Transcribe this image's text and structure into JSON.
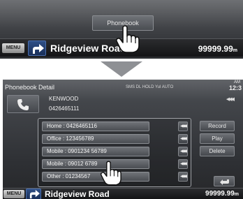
{
  "top_screen": {
    "phonebook_button_label": "Phonebook",
    "bottom_bar": {
      "menu_label": "MENU",
      "street": "Ridgeview Road",
      "distance_value": "99999.99",
      "distance_unit": "m"
    }
  },
  "bottom_screen": {
    "title": "Phonebook Detail",
    "status_indicators": "SMS DL HOLD Yul   AUTO",
    "clock_ampm": "AM",
    "clock": "12:3",
    "contact": {
      "name": "KENWOOD",
      "number": "0426465111"
    },
    "numbers": [
      {
        "label": "Home : 0426465116"
      },
      {
        "label": "Office : 123456789"
      },
      {
        "label": "Mobile : 0901234 56789"
      },
      {
        "label": "Mobile : 09012 6789"
      },
      {
        "label": "Other : 01234567"
      }
    ],
    "side_buttons": {
      "record": "Record",
      "play": "Play",
      "delete": "Delete"
    },
    "bottom_bar": {
      "menu_label": "MENU",
      "street": "Ridgeview Road",
      "distance_value": "99999.99",
      "distance_unit": "m"
    }
  },
  "icons": {
    "turn": "turn-right-arrow-icon",
    "phone": "phone-handset-icon",
    "hand": "pointing-hand-icon",
    "down_arrow": "down-triangle-icon",
    "back": "back-arrow-icon",
    "dial": "dial-arrow-icon"
  },
  "colors": {
    "screen_bg": "#3a3c40",
    "turn_box": "#2f4f86",
    "arrow_gray": "#8e9094",
    "text": "#ffffff"
  }
}
